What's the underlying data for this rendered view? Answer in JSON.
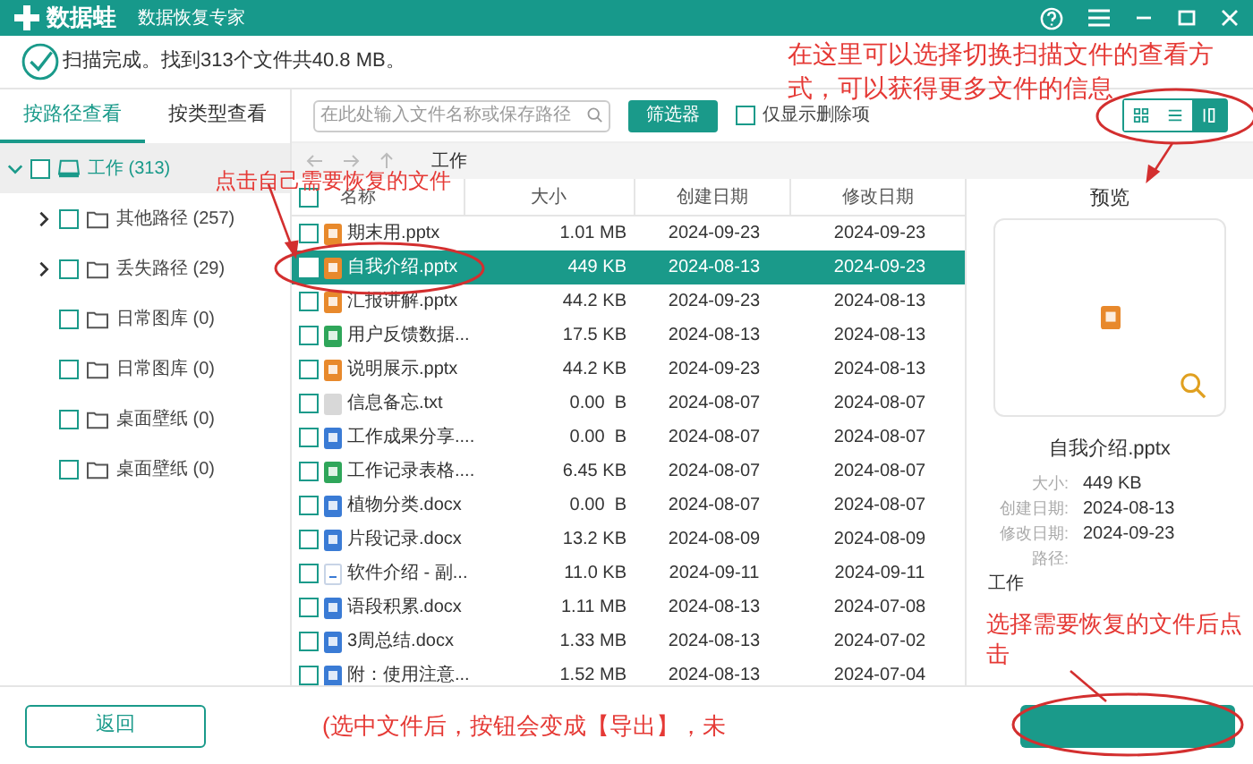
{
  "title_bar": {
    "logo": "数据蛙",
    "subtitle": "数据恢复专家"
  },
  "status": "扫描完成。找到313个文件共40.8 MB。",
  "view_tabs": [
    {
      "label": "按路径查看",
      "selected": true
    },
    {
      "label": "按类型查看",
      "selected": false
    }
  ],
  "tree": [
    {
      "label": "工作 (313)",
      "expanded": true,
      "checked": false,
      "selected": true,
      "children": [
        {
          "label": "其他路径 (257)",
          "expanded": false,
          "checked": false,
          "selected": false
        },
        {
          "label": "丢失路径 (29)",
          "expanded": false,
          "checked": false,
          "selected": false
        },
        {
          "label": "日常图库 (0)",
          "checked": false,
          "selected": false
        },
        {
          "label": "日常图库 (0)",
          "checked": false,
          "selected": false
        },
        {
          "label": "桌面壁纸 (0)",
          "checked": false,
          "selected": false
        },
        {
          "label": "桌面壁纸 (0)",
          "checked": false,
          "selected": false
        }
      ]
    }
  ],
  "toolbar": {
    "search": {
      "placeholder": "在此处输入文件名称或保存路径"
    },
    "filter_button": "筛选器",
    "deleted_only": {
      "label": "仅显示删除项",
      "checked": false
    },
    "view_modes": [
      {
        "kind": "grid",
        "selected": false
      },
      {
        "kind": "list",
        "selected": false
      },
      {
        "kind": "detail",
        "selected": true
      }
    ]
  },
  "path": "工作",
  "table": {
    "header_checked": false,
    "columns": [
      "名称",
      "大小",
      "创建日期",
      "修改日期"
    ],
    "rows": [
      {
        "kind": "ppt",
        "name": "期末用.pptx",
        "size": "1.01 MB",
        "created": "2024-09-23",
        "modified": "2024-09-23",
        "checked": false,
        "selected": false
      },
      {
        "kind": "ppt",
        "name": "自我介绍.pptx",
        "size": "449 KB",
        "created": "2024-08-13",
        "modified": "2024-09-23",
        "checked": false,
        "selected": true
      },
      {
        "kind": "ppt",
        "name": "汇报讲解.pptx",
        "size": "44.2 KB",
        "created": "2024-09-23",
        "modified": "2024-08-13",
        "checked": false,
        "selected": false
      },
      {
        "kind": "sheet",
        "name": "用户反馈数据...",
        "size": "17.5 KB",
        "created": "2024-08-13",
        "modified": "2024-08-13",
        "checked": false,
        "selected": false
      },
      {
        "kind": "ppt",
        "name": "说明展示.pptx",
        "size": "44.2 KB",
        "created": "2024-09-23",
        "modified": "2024-08-13",
        "checked": false,
        "selected": false
      },
      {
        "kind": "text",
        "name": "信息备忘.txt",
        "size": "0.00  B",
        "created": "2024-08-07",
        "modified": "2024-08-07",
        "checked": false,
        "selected": false
      },
      {
        "kind": "doc",
        "name": "工作成果分享....",
        "size": "0.00  B",
        "created": "2024-08-07",
        "modified": "2024-08-07",
        "checked": false,
        "selected": false
      },
      {
        "kind": "sheet",
        "name": "工作记录表格....",
        "size": "6.45 KB",
        "created": "2024-08-07",
        "modified": "2024-08-07",
        "checked": false,
        "selected": false
      },
      {
        "kind": "doc",
        "name": "植物分类.docx",
        "size": "0.00  B",
        "created": "2024-08-07",
        "modified": "2024-08-07",
        "checked": false,
        "selected": false
      },
      {
        "kind": "doc",
        "name": "片段记录.docx",
        "size": "13.2 KB",
        "created": "2024-08-09",
        "modified": "2024-08-09",
        "checked": false,
        "selected": false
      },
      {
        "kind": "file",
        "name": "软件介绍 - 副...",
        "size": "11.0 KB",
        "created": "2024-09-11",
        "modified": "2024-09-11",
        "checked": false,
        "selected": false
      },
      {
        "kind": "doc",
        "name": "语段积累.docx",
        "size": "1.11 MB",
        "created": "2024-08-13",
        "modified": "2024-07-08",
        "checked": false,
        "selected": false
      },
      {
        "kind": "doc",
        "name": "3周总结.docx",
        "size": "1.33 MB",
        "created": "2024-08-13",
        "modified": "2024-07-02",
        "checked": false,
        "selected": false
      },
      {
        "kind": "doc",
        "name": "附：使用注意...",
        "size": "1.52 MB",
        "created": "2024-08-13",
        "modified": "2024-07-04",
        "checked": false,
        "selected": false
      }
    ]
  },
  "preview": {
    "title": "预览",
    "kind": "ppt",
    "file_name": "自我介绍.pptx",
    "details": [
      {
        "label": "大小:",
        "value": "449 KB"
      },
      {
        "label": "创建日期:",
        "value": "2024-08-13"
      },
      {
        "label": "修改日期:",
        "value": "2024-09-23"
      },
      {
        "label": "路径:"
      }
    ],
    "path_value": "工作"
  },
  "bottom": {
    "back_button": "返回"
  },
  "annotations": [
    {
      "text": "在这里可以选择切换扫描文件的查看方式，可以获得更多文件的信息"
    },
    {
      "text": "点击自己需要恢复的文件"
    },
    {
      "text": "选择需要恢复的文件后点击"
    },
    {
      "text": "(选中文件后，按钮会变成【导出】，未"
    }
  ]
}
